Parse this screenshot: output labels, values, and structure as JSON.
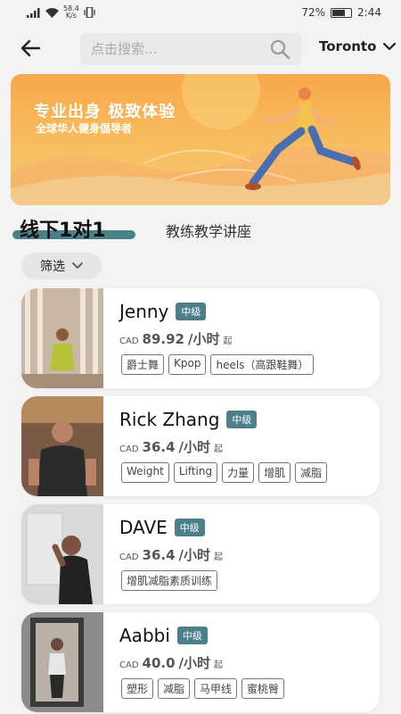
{
  "status_bar": {
    "netspeed_value": "58.4",
    "netspeed_unit": "K/s",
    "battery": "72%",
    "time": "2:44",
    "battery_level": 0.72
  },
  "header": {
    "search_placeholder": "点击搜索...",
    "city": "Toronto"
  },
  "banner": {
    "title": "专业出身  极致体验",
    "subtitle": "全球华人健身倡导者"
  },
  "tabs": {
    "active": "线下1对1",
    "other": "教练教学讲座"
  },
  "filter": {
    "label": "筛选"
  },
  "coaches": [
    {
      "name": "Jenny",
      "level": "中级",
      "currency": "CAD",
      "price": "89.92",
      "unit": "/小时",
      "suffix": "起",
      "tags": [
        "爵士舞",
        "Kpop",
        "heels（高跟鞋舞）"
      ]
    },
    {
      "name": "Rick Zhang",
      "level": "中级",
      "currency": "CAD",
      "price": "36.4",
      "unit": "/小时",
      "suffix": "起",
      "tags": [
        "Weight",
        "Lifting",
        "力量",
        "增肌",
        "减脂"
      ]
    },
    {
      "name": "DAVE",
      "level": "中级",
      "currency": "CAD",
      "price": "36.4",
      "unit": "/小时",
      "suffix": "起",
      "tags": [
        "增肌减脂素质训练"
      ]
    },
    {
      "name": "Aabbi",
      "level": "中级",
      "currency": "CAD",
      "price": "40.0",
      "unit": "/小时",
      "suffix": "起",
      "tags": [
        "塑形",
        "减脂",
        "马甲线",
        "蜜桃臀"
      ]
    }
  ],
  "colors": {
    "accent": "#4b7f8a",
    "banner": "#f7a84a"
  }
}
